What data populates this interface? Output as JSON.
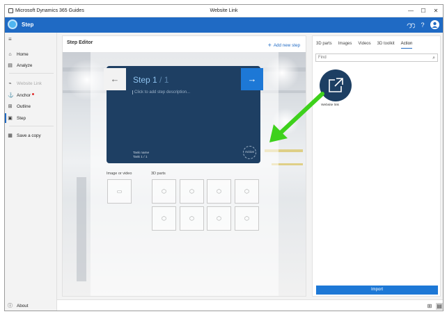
{
  "titlebar": {
    "app_name": "Microsoft Dynamics 365 Guides",
    "document_title": "Website Link",
    "minimize": "—",
    "maximize": "☐",
    "close": "✕"
  },
  "header": {
    "title": "Step",
    "help_glyph": "?"
  },
  "sidebar": {
    "items": [
      {
        "label": "Home",
        "icon": "home-icon"
      },
      {
        "label": "Analyze",
        "icon": "analyze-icon"
      },
      {
        "label": "Website Link",
        "icon": "link-icon",
        "disabled": true
      },
      {
        "label": "Anchor",
        "icon": "anchor-icon",
        "has_alert": true
      },
      {
        "label": "Outline",
        "icon": "outline-icon"
      },
      {
        "label": "Step",
        "icon": "step-icon",
        "active": true
      },
      {
        "label": "Save a copy",
        "icon": "save-icon"
      },
      {
        "label": "About",
        "icon": "info-icon"
      }
    ]
  },
  "editor": {
    "title": "Step Editor",
    "add_step": "Add new step",
    "step_label": "Step 1",
    "step_total": "/ 1",
    "description_placeholder": "Click to add step description...",
    "task_name_label": "Task name",
    "task_value": "Task 1 / 1",
    "action_label": "Action",
    "image_or_video_label": "Image or video",
    "parts_label": "3D parts"
  },
  "right_panel": {
    "tabs": [
      "3D parts",
      "Images",
      "Videos",
      "3D toolkit",
      "Action"
    ],
    "selected_tab": "Action",
    "search_placeholder": "Find",
    "tile_label": "Website link",
    "import_button": "Import"
  },
  "colors": {
    "accent": "#1f6ac4",
    "card": "#1e3f63",
    "annotation_arrow": "#3ed11c"
  }
}
